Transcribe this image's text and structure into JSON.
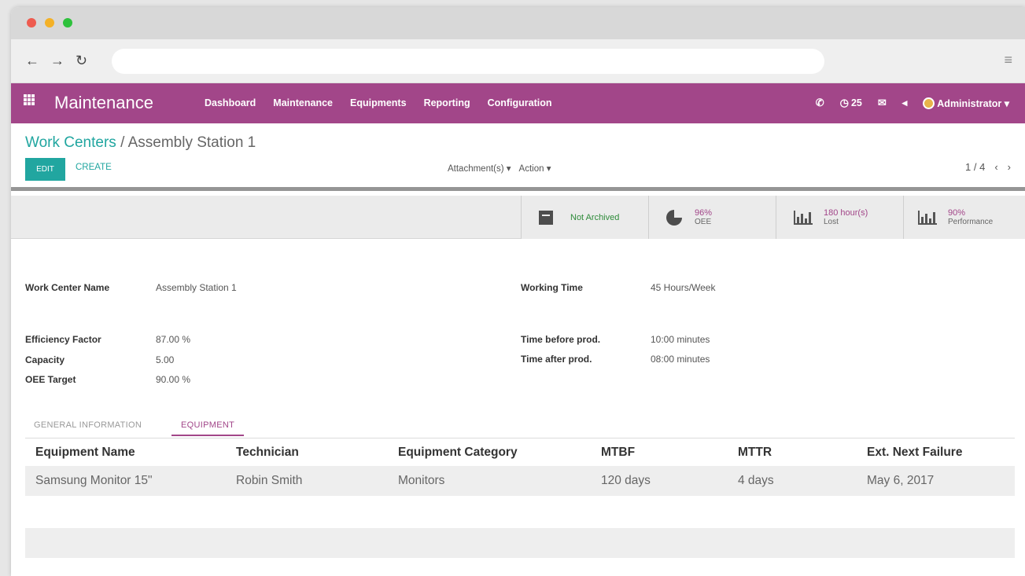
{
  "browser": {
    "url": ""
  },
  "appbar": {
    "title": "Maintenance",
    "menu": [
      "Dashboard",
      "Maintenance",
      "Equipments",
      "Reporting",
      "Configuration"
    ],
    "badge_count": "25",
    "user": "Administrator"
  },
  "breadcrumb": {
    "parent": "Work Centers",
    "separator": " / ",
    "current": "Assembly Station 1"
  },
  "controls": {
    "edit_label": "EDIT",
    "create_label": "CREATE",
    "attachments_label": "Attachment(s) ▾",
    "action_label": "Action ▾",
    "pager": "1 / 4"
  },
  "stats": [
    {
      "value": "Not Archived",
      "label": ""
    },
    {
      "value": "96%",
      "label": "OEE"
    },
    {
      "value": "180 hour(s)",
      "label": "Lost"
    },
    {
      "value": "90%",
      "label": "Performance"
    }
  ],
  "fields": {
    "work_center_name": {
      "label": "Work Center Name",
      "value": "Assembly Station 1"
    },
    "working_time": {
      "label": "Working Time",
      "value": "45 Hours/Week"
    },
    "efficiency": {
      "label": "Efficiency Factor",
      "value": "87.00 %"
    },
    "capacity": {
      "label": "Capacity",
      "value": "5.00"
    },
    "oee_target": {
      "label": "OEE Target",
      "value": "90.00 %"
    },
    "time_before": {
      "label": "Time before prod.",
      "value": "10:00 minutes"
    },
    "time_after": {
      "label": "Time after prod.",
      "value": "08:00 minutes"
    }
  },
  "tabs": [
    "GENERAL INFORMATION",
    "EQUIPMENT"
  ],
  "table": {
    "headers": [
      "Equipment Name",
      "Technician",
      "Equipment Category",
      "MTBF",
      "MTTR",
      "Ext. Next Failure"
    ],
    "rows": [
      [
        "Samsung Monitor 15\"",
        "Robin Smith",
        "Monitors",
        "120 days",
        "4 days",
        "May 6, 2017"
      ]
    ]
  },
  "colors": {
    "brand": "#a24689",
    "accent": "#21a6a0"
  }
}
